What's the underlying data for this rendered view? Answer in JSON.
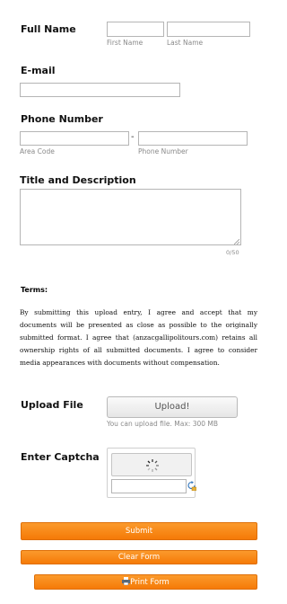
{
  "full_name": {
    "label": "Full Name",
    "first_placeholder": "",
    "first_sublabel": "First Name",
    "last_placeholder": "",
    "last_sublabel": "Last Name"
  },
  "email": {
    "label": "E-mail",
    "value": ""
  },
  "phone": {
    "label": "Phone Number",
    "area_sublabel": "Area Code",
    "separator": "-",
    "number_sublabel": "Phone Number"
  },
  "title_desc": {
    "label": "Title and Description",
    "counter": "0/50"
  },
  "terms": {
    "heading": "Terms:",
    "text": "By submitting this upload entry, I agree and accept that my documents will be presented as close as possible to the originally submitted format. I agree that (anzacgallipolitours.com) retains all ownership rights of all submitted documents. I agree to consider media appearances with documents without compensation."
  },
  "upload": {
    "label": "Upload File",
    "button_label": "Upload!",
    "hint": "You can upload file. Max: 300 MB"
  },
  "captcha": {
    "label": "Enter Captcha"
  },
  "buttons": {
    "submit": "Submit",
    "clear": "Clear Form",
    "print": "Print Form"
  },
  "colors": {
    "accent": "#f68512",
    "border": "#b5b5b5"
  }
}
